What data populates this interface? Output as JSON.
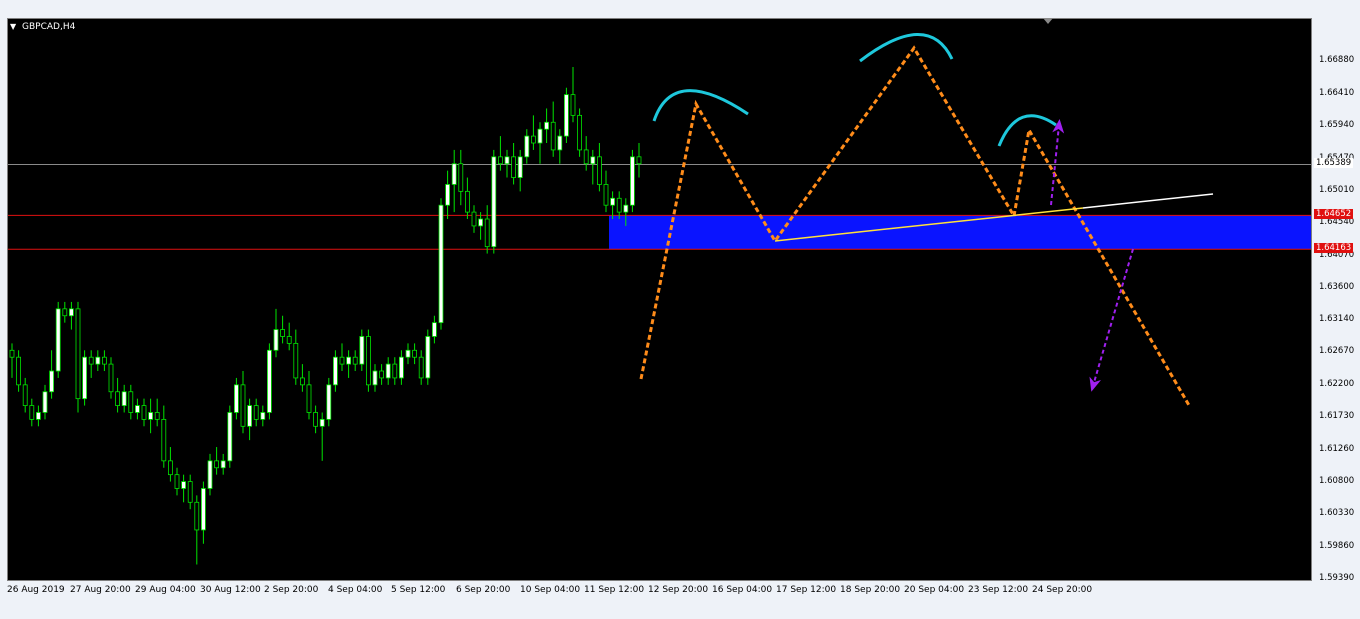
{
  "window": {
    "symbol_label": "GBPCAD,H4",
    "menu_icon": "triangle-down-icon"
  },
  "colors": {
    "background": "#000000",
    "bull": "#ffffff",
    "bear": "#000000",
    "wick": "#00e600",
    "zone": "#0a14ff",
    "level_line": "#e01010",
    "bid_line": "#8a8a8a",
    "pattern": "#ff8c1a",
    "head_shoulder_arc": "#1ec8dc",
    "neckline": "#ffe13c",
    "projection_arrows": "#a020f0"
  },
  "price_axis": {
    "ticks": [
      "1.66880",
      "1.66410",
      "1.65940",
      "1.65470",
      "1.65010",
      "1.64540",
      "1.64070",
      "1.63600",
      "1.63140",
      "1.62670",
      "1.62200",
      "1.61730",
      "1.61260",
      "1.60800",
      "1.60330",
      "1.59860",
      "1.59390"
    ],
    "current_price": "1.65389",
    "level_upper": "1.64652",
    "level_lower": "1.64163"
  },
  "time_axis": {
    "labels": [
      "26 Aug 2019",
      "27 Aug 20:00",
      "29 Aug 04:00",
      "30 Aug 12:00",
      "2 Sep 20:00",
      "4 Sep 04:00",
      "5 Sep 12:00",
      "6 Sep 20:00",
      "10 Sep 04:00",
      "11 Sep 12:00",
      "12 Sep 20:00",
      "16 Sep 04:00",
      "17 Sep 12:00",
      "18 Sep 20:00",
      "20 Sep 04:00",
      "23 Sep 12:00",
      "24 Sep 20:00"
    ]
  },
  "chart_data": {
    "type": "candlestick",
    "symbol": "GBPCAD",
    "timeframe": "H4",
    "ylim": [
      1.5939,
      1.6735
    ],
    "candles": [
      [
        1.627,
        1.628,
        1.623,
        1.626
      ],
      [
        1.626,
        1.627,
        1.621,
        1.622
      ],
      [
        1.622,
        1.623,
        1.618,
        1.619
      ],
      [
        1.619,
        1.62,
        1.616,
        1.617
      ],
      [
        1.617,
        1.619,
        1.616,
        1.618
      ],
      [
        1.618,
        1.622,
        1.617,
        1.621
      ],
      [
        1.621,
        1.627,
        1.62,
        1.624
      ],
      [
        1.624,
        1.634,
        1.623,
        1.633
      ],
      [
        1.633,
        1.634,
        1.631,
        1.632
      ],
      [
        1.632,
        1.634,
        1.63,
        1.633
      ],
      [
        1.633,
        1.634,
        1.618,
        1.62
      ],
      [
        1.62,
        1.627,
        1.619,
        1.626
      ],
      [
        1.626,
        1.627,
        1.623,
        1.625
      ],
      [
        1.625,
        1.627,
        1.624,
        1.626
      ],
      [
        1.626,
        1.627,
        1.624,
        1.625
      ],
      [
        1.625,
        1.626,
        1.62,
        1.621
      ],
      [
        1.621,
        1.623,
        1.618,
        1.619
      ],
      [
        1.619,
        1.622,
        1.618,
        1.621
      ],
      [
        1.621,
        1.622,
        1.617,
        1.618
      ],
      [
        1.618,
        1.62,
        1.617,
        1.619
      ],
      [
        1.619,
        1.62,
        1.616,
        1.617
      ],
      [
        1.617,
        1.62,
        1.615,
        1.618
      ],
      [
        1.618,
        1.62,
        1.616,
        1.617
      ],
      [
        1.617,
        1.619,
        1.61,
        1.611
      ],
      [
        1.611,
        1.613,
        1.608,
        1.609
      ],
      [
        1.609,
        1.61,
        1.606,
        1.607
      ],
      [
        1.607,
        1.609,
        1.605,
        1.608
      ],
      [
        1.608,
        1.609,
        1.604,
        1.605
      ],
      [
        1.605,
        1.606,
        1.596,
        1.601
      ],
      [
        1.601,
        1.608,
        1.599,
        1.607
      ],
      [
        1.607,
        1.612,
        1.606,
        1.611
      ],
      [
        1.611,
        1.613,
        1.609,
        1.61
      ],
      [
        1.61,
        1.612,
        1.609,
        1.611
      ],
      [
        1.611,
        1.619,
        1.61,
        1.618
      ],
      [
        1.618,
        1.623,
        1.617,
        1.622
      ],
      [
        1.622,
        1.624,
        1.615,
        1.616
      ],
      [
        1.616,
        1.62,
        1.614,
        1.619
      ],
      [
        1.619,
        1.62,
        1.616,
        1.617
      ],
      [
        1.617,
        1.619,
        1.616,
        1.618
      ],
      [
        1.618,
        1.628,
        1.617,
        1.627
      ],
      [
        1.627,
        1.633,
        1.626,
        1.63
      ],
      [
        1.63,
        1.632,
        1.628,
        1.629
      ],
      [
        1.629,
        1.631,
        1.627,
        1.628
      ],
      [
        1.628,
        1.63,
        1.622,
        1.623
      ],
      [
        1.623,
        1.625,
        1.621,
        1.622
      ],
      [
        1.622,
        1.624,
        1.617,
        1.618
      ],
      [
        1.618,
        1.619,
        1.615,
        1.616
      ],
      [
        1.616,
        1.618,
        1.611,
        1.617
      ],
      [
        1.617,
        1.623,
        1.616,
        1.622
      ],
      [
        1.622,
        1.627,
        1.621,
        1.626
      ],
      [
        1.626,
        1.628,
        1.624,
        1.625
      ],
      [
        1.625,
        1.627,
        1.623,
        1.626
      ],
      [
        1.626,
        1.627,
        1.624,
        1.625
      ],
      [
        1.625,
        1.63,
        1.624,
        1.629
      ],
      [
        1.629,
        1.63,
        1.621,
        1.622
      ],
      [
        1.622,
        1.625,
        1.621,
        1.624
      ],
      [
        1.624,
        1.625,
        1.622,
        1.623
      ],
      [
        1.623,
        1.626,
        1.622,
        1.625
      ],
      [
        1.625,
        1.626,
        1.622,
        1.623
      ],
      [
        1.623,
        1.627,
        1.622,
        1.626
      ],
      [
        1.626,
        1.628,
        1.625,
        1.627
      ],
      [
        1.627,
        1.628,
        1.625,
        1.626
      ],
      [
        1.626,
        1.627,
        1.622,
        1.623
      ],
      [
        1.623,
        1.63,
        1.622,
        1.629
      ],
      [
        1.629,
        1.632,
        1.628,
        1.631
      ],
      [
        1.631,
        1.649,
        1.63,
        1.648
      ],
      [
        1.648,
        1.653,
        1.646,
        1.651
      ],
      [
        1.651,
        1.656,
        1.647,
        1.654
      ],
      [
        1.654,
        1.656,
        1.648,
        1.65
      ],
      [
        1.65,
        1.652,
        1.646,
        1.647
      ],
      [
        1.647,
        1.648,
        1.644,
        1.645
      ],
      [
        1.645,
        1.647,
        1.643,
        1.646
      ],
      [
        1.646,
        1.648,
        1.641,
        1.642
      ],
      [
        1.642,
        1.656,
        1.641,
        1.655
      ],
      [
        1.655,
        1.658,
        1.653,
        1.654
      ],
      [
        1.654,
        1.656,
        1.652,
        1.655
      ],
      [
        1.655,
        1.657,
        1.651,
        1.652
      ],
      [
        1.652,
        1.656,
        1.65,
        1.655
      ],
      [
        1.655,
        1.659,
        1.654,
        1.658
      ],
      [
        1.658,
        1.661,
        1.656,
        1.657
      ],
      [
        1.657,
        1.66,
        1.654,
        1.659
      ],
      [
        1.659,
        1.662,
        1.657,
        1.66
      ],
      [
        1.66,
        1.663,
        1.655,
        1.656
      ],
      [
        1.656,
        1.659,
        1.654,
        1.658
      ],
      [
        1.658,
        1.665,
        1.657,
        1.664
      ],
      [
        1.664,
        1.668,
        1.66,
        1.661
      ],
      [
        1.661,
        1.662,
        1.655,
        1.656
      ],
      [
        1.656,
        1.658,
        1.653,
        1.654
      ],
      [
        1.654,
        1.656,
        1.651,
        1.655
      ],
      [
        1.655,
        1.657,
        1.65,
        1.651
      ],
      [
        1.651,
        1.653,
        1.647,
        1.648
      ],
      [
        1.648,
        1.65,
        1.646,
        1.649
      ],
      [
        1.649,
        1.65,
        1.646,
        1.647
      ],
      [
        1.647,
        1.649,
        1.645,
        1.648
      ],
      [
        1.648,
        1.656,
        1.647,
        1.655
      ],
      [
        1.655,
        1.657,
        1.652,
        1.654
      ]
    ],
    "horizontal_levels": [
      1.64652,
      1.64163
    ],
    "bid": 1.65389,
    "annotations": [
      "head-and-shoulders",
      "neckline",
      "target-projection"
    ]
  }
}
